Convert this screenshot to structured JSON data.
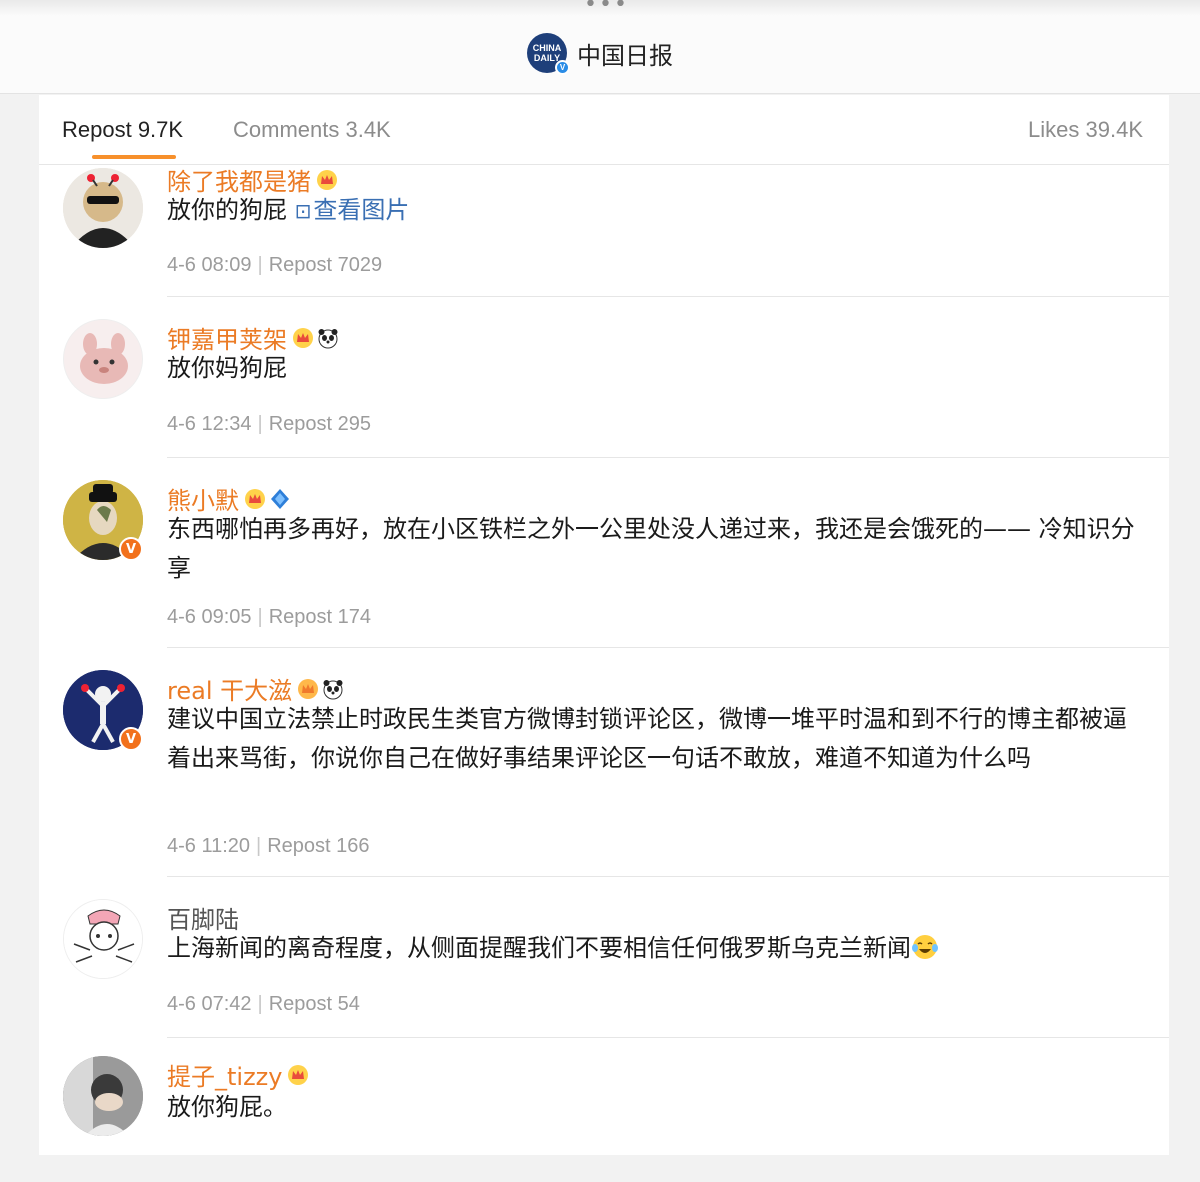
{
  "header": {
    "dots": "•••",
    "account_name": "中国日报",
    "logo_line1": "CHINA",
    "logo_line2": "DAILY",
    "verified_mark": "V"
  },
  "tabs": {
    "repost": "Repost 9.7K",
    "comments": "Comments 3.4K",
    "likes": "Likes 39.4K"
  },
  "colors": {
    "accent": "#f7902b",
    "username": "#eb7b25",
    "link": "#3a6fb3",
    "meta": "#9c9c9c"
  },
  "reposts": [
    {
      "username": "除了我都是猪",
      "text": "放你的狗屁 ",
      "link_icon": "image-icon",
      "link_text": "查看图片",
      "time": "4-6 08:09",
      "repost_label": "Repost 7029",
      "badges": [
        "crown-icon"
      ]
    },
    {
      "username": "钾嘉甲荚架",
      "text": "放你妈狗屁",
      "time": "4-6 12:34",
      "repost_label": "Repost 295",
      "badges": [
        "crown-icon",
        "panda-icon"
      ]
    },
    {
      "username": "熊小默",
      "text": "东西哪怕再多再好，放在小区铁栏之外一公里处没人递过来，我还是会饿死的—— 冷知识分享",
      "time": "4-6 09:05",
      "repost_label": "Repost 174",
      "badges": [
        "crown-icon",
        "blue-shield-icon"
      ],
      "avatar_verified": "V"
    },
    {
      "username": "real 干大滋",
      "text": "建议中国立法禁止时政民生类官方微博封锁评论区，微博一堆平时温和到不行的博主都被逼着出来骂街，你说你自己在做好事结果评论区一句话不敢放，难道不知道为什么吗",
      "time": "4-6 11:20",
      "repost_label": "Repost 166",
      "badges": [
        "crown-icon",
        "panda-icon"
      ],
      "avatar_verified": "V"
    },
    {
      "username": "百脚陆",
      "text": "上海新闻的离奇程度，从侧面提醒我们不要相信任何俄罗斯乌克兰新闻",
      "time": "4-6 07:42",
      "repost_label": "Repost 54",
      "badges": [],
      "trailing_emoji": "laugh-cry-icon"
    },
    {
      "username": "提子_tizzy",
      "text": "放你狗屁。",
      "badges": [
        "crown-icon"
      ]
    }
  ]
}
